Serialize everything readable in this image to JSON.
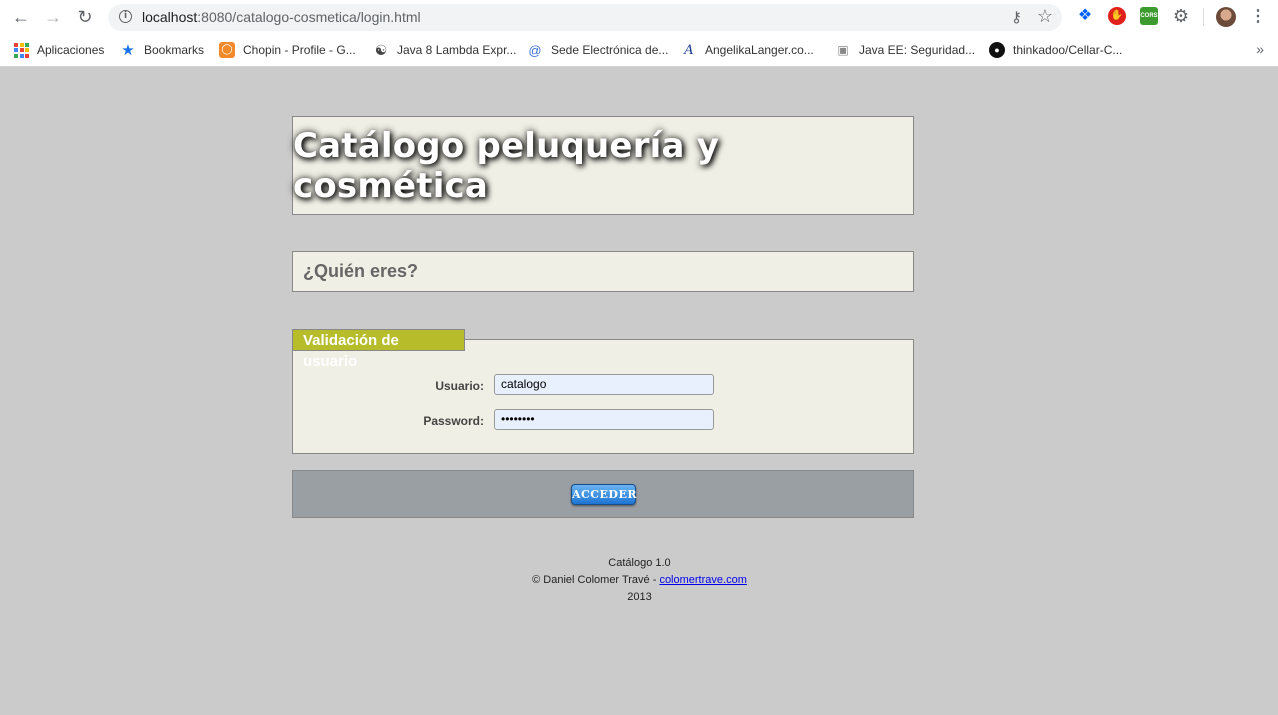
{
  "browser": {
    "url_host": "localhost",
    "url_path": ":8080/catalogo-cosmetica/login.html",
    "bookmarks": [
      {
        "label": "Aplicaciones",
        "icon": "apps-grid-icon"
      },
      {
        "label": "Bookmarks",
        "icon": "star-icon"
      },
      {
        "label": "Chopin - Profile - G...",
        "icon": "chopin-icon"
      },
      {
        "label": "Java 8 Lambda Expr...",
        "icon": "globe-icon"
      },
      {
        "label": "Sede Electrónica de...",
        "icon": "at-icon"
      },
      {
        "label": "AngelikaLanger.co...",
        "icon": "angelika-icon"
      },
      {
        "label": "Java EE: Seguridad...",
        "icon": "camera-icon"
      },
      {
        "label": "thinkadoo/Cellar-C...",
        "icon": "github-icon"
      }
    ],
    "extensions": [
      "dropbox-icon",
      "adblock-icon",
      "cors-icon",
      "gear-icon"
    ]
  },
  "page": {
    "title": "Catálogo peluquería y cosmética",
    "subtitle": "¿Quién eres?",
    "form": {
      "legend": "Validación de usuario",
      "username_label": "Usuario:",
      "username_value": "catalogo",
      "password_label": "Password:",
      "password_value": "••••••••"
    },
    "submit_label": "ACCEDER",
    "footer": {
      "line1": "Catálogo 1.0",
      "line2_prefix": "© Daniel Colomer Travé - ",
      "link": "colomertrave.com",
      "line3": "2013"
    }
  },
  "colors": {
    "page_bg": "#cbcbcb",
    "panel_bg": "#f0efe5",
    "legend_bg": "#b7bd2a",
    "button_bar_bg": "#9a9fa3",
    "button_blue": "#1d74d1"
  }
}
